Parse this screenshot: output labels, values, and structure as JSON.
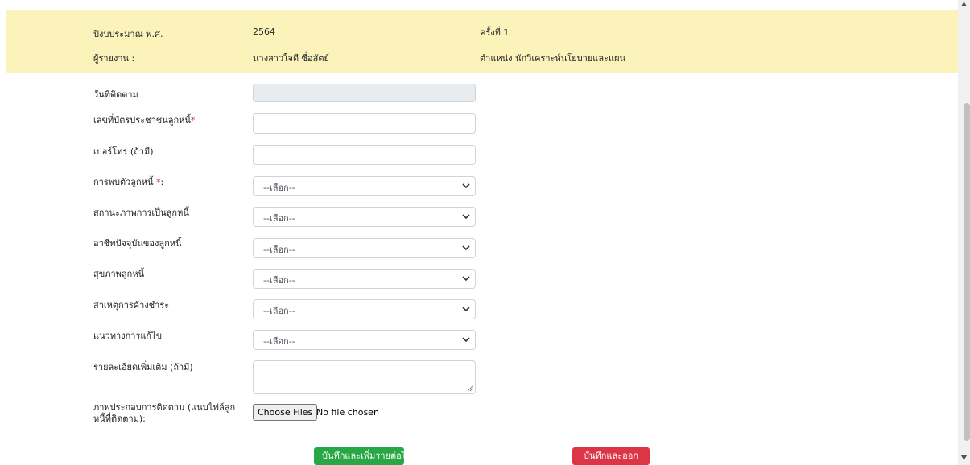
{
  "header": {
    "fiscal_year_label": "ปีงบประมาณ พ.ศ.",
    "fiscal_year_value": "2564",
    "round_label": "ครั้งที่ 1",
    "reporter_label": "ผู้รายงาน :",
    "reporter_value": "นางสาวใจดี ซื่อสัตย์",
    "position_label": "ตำแหน่ง นักวิเคราะห์นโยบายและแผน"
  },
  "form": {
    "follow_date_label": "วันที่ติดตาม",
    "follow_date_value": "",
    "id_card_label": "เลขที่บัตรประชาชนลูกหนี้",
    "id_card_required": "*",
    "id_card_value": "",
    "phone_label": "เบอร์โทร (ถ้ามี)",
    "phone_value": "",
    "found_label": "การพบตัวลูกหนี้ ",
    "found_required": "*",
    "found_suffix": ":",
    "found_value": "--เลือก--",
    "status_label": "สถานะภาพการเป็นลูกหนี้",
    "status_value": "--เลือก--",
    "occupation_label": "อาชีพปัจจุบันของลูกหนี้",
    "occupation_value": "--เลือก--",
    "health_label": "สุขภาพลูกหนี้",
    "health_value": "--เลือก--",
    "cause_label": "สาเหตุการค้างชำระ",
    "cause_value": "--เลือก--",
    "solution_label": "แนวทางการแก้ไข",
    "solution_value": "--เลือก--",
    "details_label": "รายละเอียดเพิ่มเติม (ถ้ามี)",
    "details_value": "",
    "photo_label_line1": "ภาพประกอบการติดตาม (แนบไฟล์ลูก",
    "photo_label_line2": "หนี้ที่ติดตาม):",
    "file_button": "Choose Files",
    "file_status": "No file chosen"
  },
  "actions": {
    "save_next": "บันทึกและเพิ่มรายต่อไป",
    "save_exit": "บันทึกและออก"
  },
  "colors": {
    "info_bg": "#fbf3b9",
    "primary_green": "#28a745",
    "danger_red": "#dc3545"
  }
}
